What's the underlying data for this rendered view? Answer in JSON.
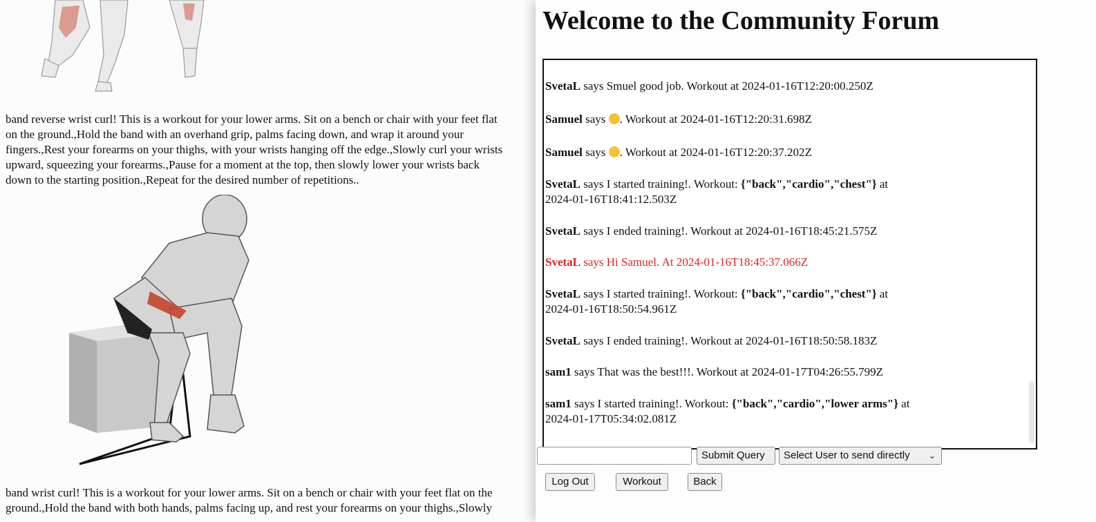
{
  "workout_page": {
    "exercise1_text_lines": [
      "band reverse wrist curl! This is a workout for your lower arms. Sit on a bench or chair with your feet flat",
      "on the ground.,Hold the band with an overhand grip, palms facing down, and wrap it around your",
      "fingers.,Rest your forearms on your thighs, with your wrists hanging off the edge.,Slowly curl your wrists",
      "upward, squeezing your forearms.,Pause for a moment at the top, then slowly lower your wrists back",
      "down to the starting position.,Repeat for the desired number of repetitions.."
    ],
    "exercise2_text_lines": [
      "band wrist curl! This is a workout for your lower arms. Sit on a bench or chair with your feet flat on the",
      "ground.,Hold the band with both hands, palms facing up, and rest your forearms on your thighs.,Slowly"
    ]
  },
  "forum": {
    "title": "Welcome to the Community Forum",
    "messages": [
      {
        "user": "SvetaL",
        "text": " says Smuel good job. Workout at 2024-01-16T12:20:00.250Z"
      },
      {
        "user": "Samuel",
        "pre": " says ",
        "post": ". Workout at 2024-01-16T12:20:31.698Z"
      },
      {
        "user": "Samuel",
        "pre": " says ",
        "post": ". Workout at 2024-01-16T12:20:37.202Z"
      },
      {
        "user": "SvetaL",
        "pre": " says I started training!. Workout: ",
        "bold": "{\"back\",\"cardio\",\"chest\"}",
        "post": " at",
        "line2": "2024-01-16T18:41:12.503Z"
      },
      {
        "user": "SvetaL",
        "text": " says I ended training!. Workout at 2024-01-16T18:45:21.575Z"
      },
      {
        "user": "SvetaL",
        "text": " says Hi Samuel. At 2024-01-16T18:45:37.066Z"
      },
      {
        "user": "SvetaL",
        "pre": " says I started training!. Workout: ",
        "bold": "{\"back\",\"cardio\",\"chest\"}",
        "post": " at",
        "line2": "2024-01-16T18:50:54.961Z"
      },
      {
        "user": "SvetaL",
        "text": " says I ended training!. Workout at 2024-01-16T18:50:58.183Z"
      },
      {
        "user": "sam1",
        "text": " says That was the best!!!. Workout at 2024-01-17T04:26:55.799Z"
      },
      {
        "user": "sam1",
        "pre": " says I started training!. Workout: ",
        "bold": "{\"back\",\"cardio\",\"lower arms\"}",
        "post": " at",
        "line2": "2024-01-17T05:34:02.081Z"
      }
    ],
    "emoji_name": "smiling-face-emoji",
    "highlight_color": "#e02020",
    "input_value": "",
    "submit_label": "Submit Query",
    "select_label": "Select User to send directly",
    "logout_label": "Log Out",
    "workout_label": "Workout",
    "back_label": "Back"
  }
}
